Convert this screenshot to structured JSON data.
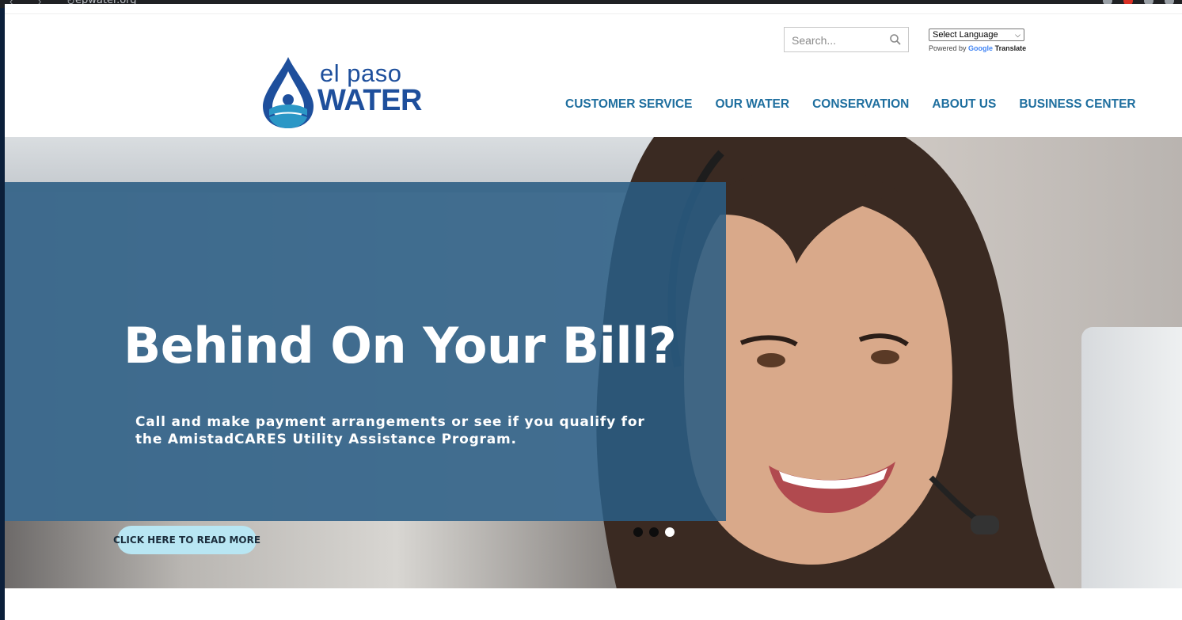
{
  "browser": {
    "url": "epwater.org"
  },
  "header": {
    "search_placeholder": "Search...",
    "language_select": "Select Language",
    "powered_by": "Powered by",
    "google": "Google",
    "translate": "Translate",
    "logo": {
      "line1": "el paso",
      "line2": "WATER"
    }
  },
  "nav": {
    "items": [
      {
        "label": "CUSTOMER SERVICE"
      },
      {
        "label": "OUR WATER"
      },
      {
        "label": "CONSERVATION"
      },
      {
        "label": "ABOUT US"
      },
      {
        "label": "BUSINESS CENTER"
      }
    ]
  },
  "hero": {
    "headline": "Behind On Your Bill?",
    "subtext": "Call and make payment arrangements or see if you qualify for the AmistadCARES Utility Assistance Program.",
    "cta_label": "CLICK HERE TO READ MORE",
    "slides_count": 3,
    "active_slide": 3
  },
  "colors": {
    "brand_blue": "#1e4f9c",
    "nav_text": "#1f6f9f",
    "panel": "#2a5c83",
    "cta_bg": "#b8e6f3"
  }
}
